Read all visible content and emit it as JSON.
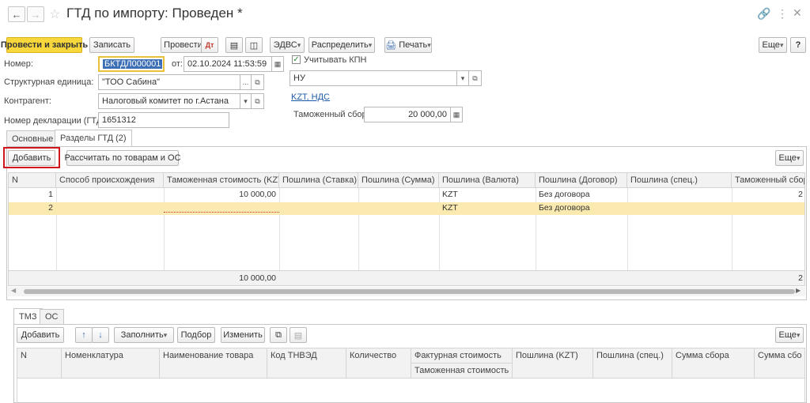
{
  "window": {
    "title": "ГТД по импорту: Проведен *"
  },
  "toolbar": {
    "post_close": "Провести и закрыть",
    "save": "Записать",
    "post": "Провести",
    "edvs": "ЭДВС",
    "distribute": "Распределить",
    "print": "Печать",
    "more": "Еще",
    "help": "?"
  },
  "form": {
    "number_label": "Номер:",
    "number_value": "БКТДЛ000001",
    "from_label": "от:",
    "date_value": "02.10.2024 11:53:59",
    "kpn_label": "Учитывать КПН",
    "kpn_checked": true,
    "unit_label": "Структурная единица:",
    "unit_value": "\"ТОО Сабина\"",
    "nu_value": "НУ",
    "contractor_label": "Контрагент:",
    "contractor_value": "Налоговый комитет по г.Астана",
    "currency_link": "KZT, НДС",
    "customs_fee_label": "Таможенный сбор:",
    "customs_fee_value": "20 000,00",
    "decl_label": "Номер декларации (ГТД):",
    "decl_value": "1651312"
  },
  "tabs": [
    "Основные",
    "Разделы ГТД (2)"
  ],
  "sections": {
    "add": "Добавить",
    "calc": "Рассчитать по товарам и ОС",
    "more": "Еще",
    "columns": [
      "N",
      "Способ происхождения",
      "Таможенная стоимость (KZT)",
      "Пошлина (Ставка)",
      "Пошлина (Сумма)",
      "Пошлина (Валюта)",
      "Пошлина (Договор)",
      "Пошлина (спец.)",
      "Таможенный сбор"
    ],
    "rows": [
      {
        "n": "1",
        "origin": "",
        "customs_value": "10 000,00",
        "rate": "",
        "sum": "",
        "currency": "KZT",
        "contract": "Без договора",
        "special": "",
        "fee": "2"
      },
      {
        "n": "2",
        "origin": "",
        "customs_value": "",
        "rate": "",
        "sum": "",
        "currency": "KZT",
        "contract": "Без договора",
        "special": "",
        "fee": ""
      }
    ],
    "footer": {
      "customs_value": "10 000,00",
      "fee": "2"
    }
  },
  "subtabs": [
    "ТМЗ",
    "ОС"
  ],
  "goods": {
    "add": "Добавить",
    "fill": "Заполнить",
    "pick": "Подбор",
    "change": "Изменить",
    "more": "Еще",
    "columns": [
      "N",
      "Номенклатура",
      "Наименование товара",
      "Код ТНВЭД",
      "Количество",
      "Фактурная стоимость",
      "Пошлина (KZT)",
      "Пошлина (спец.)",
      "Сумма сбора",
      "Сумма сбо"
    ],
    "sub_column": "Таможенная стоимость"
  },
  "colors": {
    "primary_button": "#f7d73c",
    "selected_row": "#fbeab0",
    "highlight_box": "#d0161c",
    "link": "#1d5aa8"
  }
}
